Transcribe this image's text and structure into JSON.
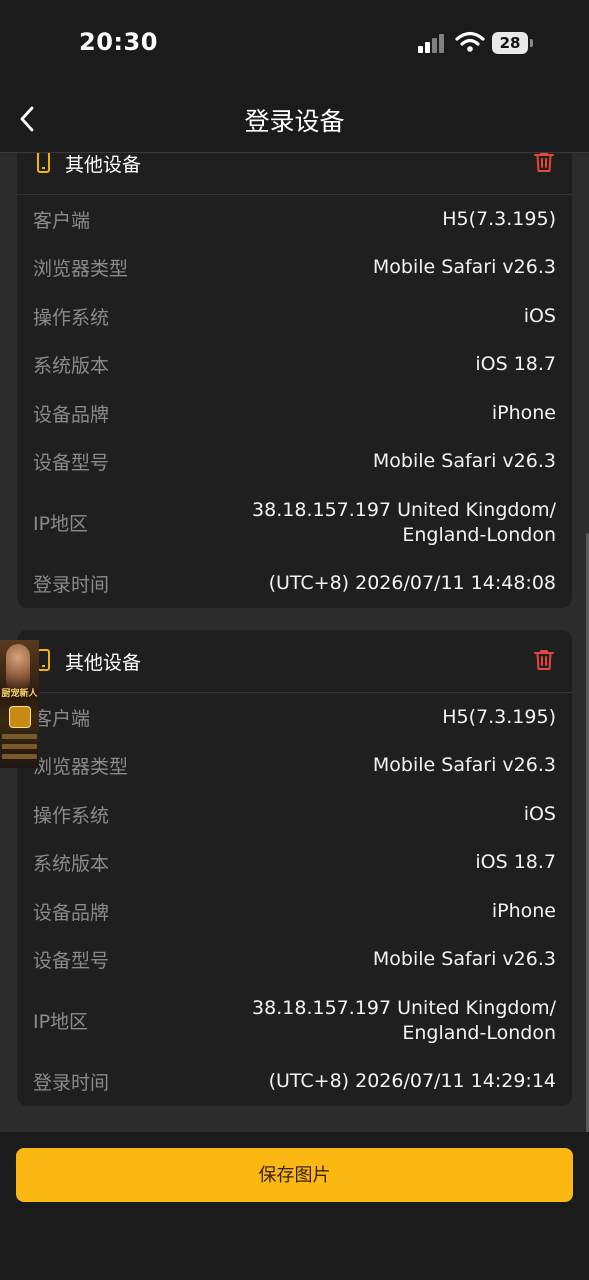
{
  "status_bar": {
    "time": "20:30",
    "battery": "28"
  },
  "nav": {
    "title": "登录设备"
  },
  "devices": [
    {
      "title": "其他设备",
      "rows": [
        {
          "label": "客户端",
          "value": "H5(7.3.195)"
        },
        {
          "label": "浏览器类型",
          "value": "Mobile Safari v26.3"
        },
        {
          "label": "操作系统",
          "value": "iOS"
        },
        {
          "label": "系统版本",
          "value": "iOS 18.7"
        },
        {
          "label": "设备品牌",
          "value": "iPhone"
        },
        {
          "label": "设备型号",
          "value": "Mobile Safari v26.3"
        },
        {
          "label": "IP地区",
          "value_line1": "38.18.157.197 United Kingdom/",
          "value_line2": "England-London"
        },
        {
          "label": "登录时间",
          "value": "(UTC+8) 2026/07/11 14:48:08"
        }
      ]
    },
    {
      "title": "其他设备",
      "rows": [
        {
          "label": "客户端",
          "value": "H5(7.3.195)"
        },
        {
          "label": "浏览器类型",
          "value": "Mobile Safari v26.3"
        },
        {
          "label": "操作系统",
          "value": "iOS"
        },
        {
          "label": "系统版本",
          "value": "iOS 18.7"
        },
        {
          "label": "设备品牌",
          "value": "iPhone"
        },
        {
          "label": "设备型号",
          "value": "Mobile Safari v26.3"
        },
        {
          "label": "IP地区",
          "value_line1": "38.18.157.197 United Kingdom/",
          "value_line2": "England-London"
        },
        {
          "label": "登录时间",
          "value": "(UTC+8) 2026/07/11 14:29:14"
        }
      ]
    }
  ],
  "floating_ad": {
    "text": "厨宠新人"
  },
  "save_button": {
    "label": "保存图片"
  },
  "colors": {
    "accent": "#fbb812",
    "delete": "#e5483a",
    "device_icon": "#f5b400"
  }
}
